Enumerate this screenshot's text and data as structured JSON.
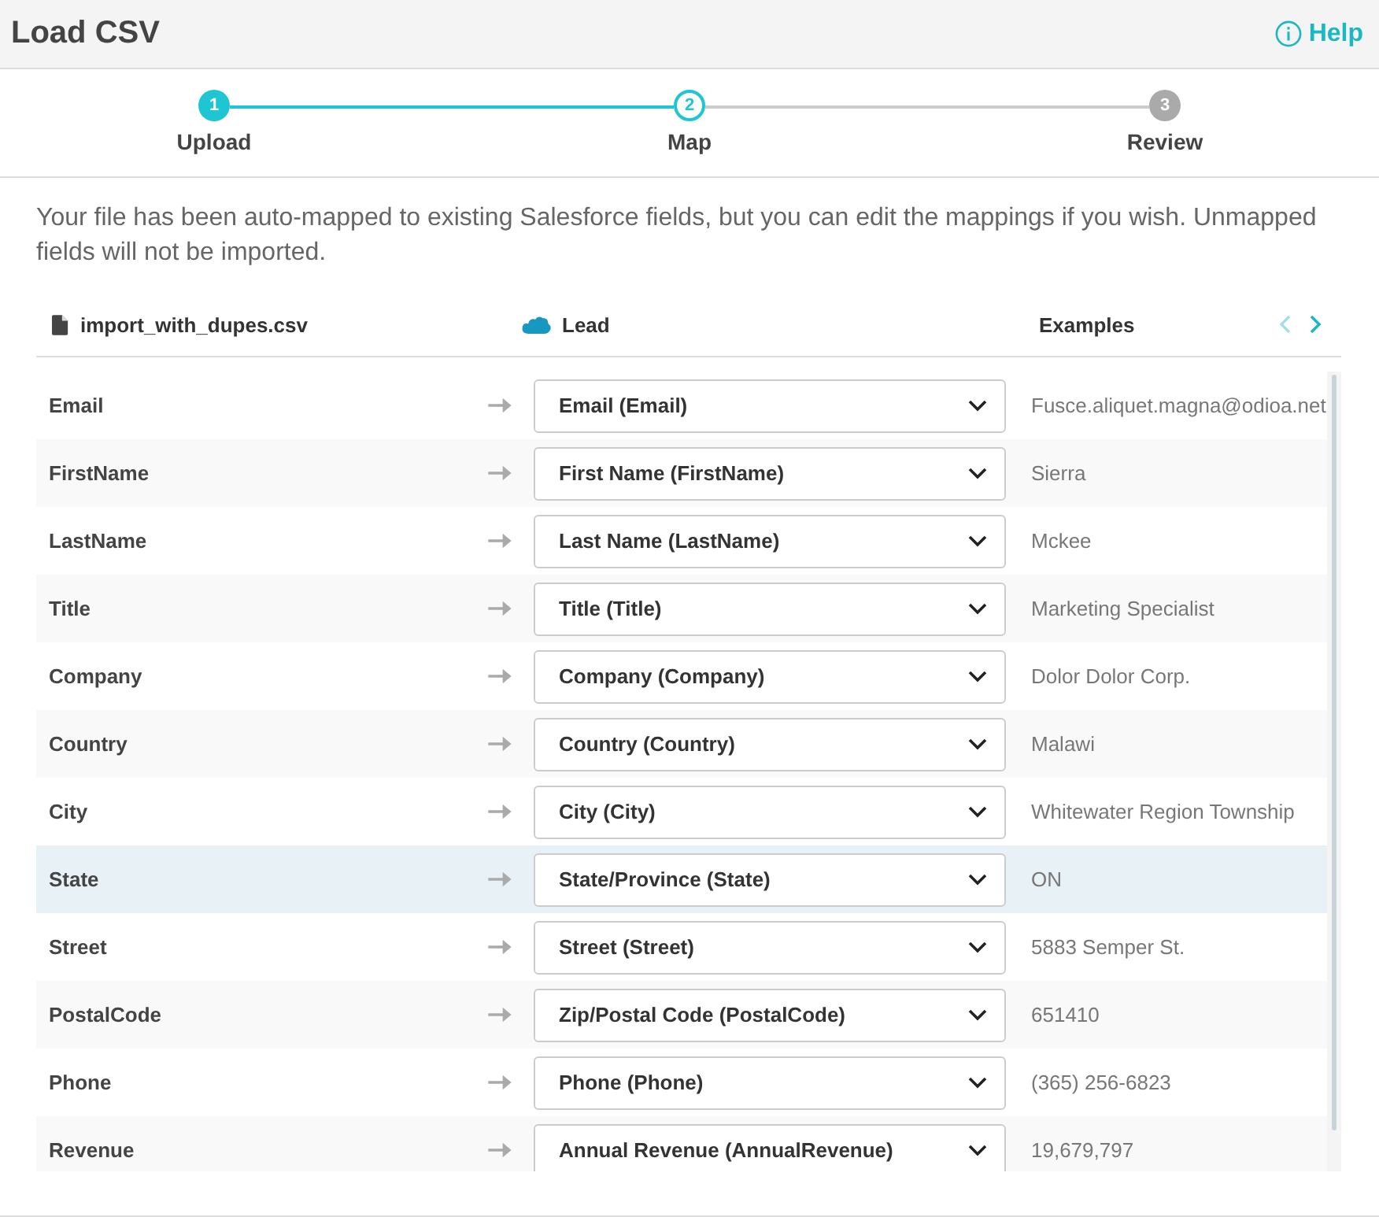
{
  "window": {
    "title": "Load CSV",
    "help": "Help"
  },
  "steps": [
    {
      "number": "1",
      "label": "Upload",
      "completed": true,
      "selected": false
    },
    {
      "number": "2",
      "label": "Map",
      "completed": false,
      "selected": true
    },
    {
      "number": "3",
      "label": "Review",
      "completed": false,
      "selected": false
    }
  ],
  "description": "Your file has been auto-mapped to existing Salesforce fields, but you can edit the mappings if you wish. Unmapped fields will not be imported.",
  "columns": {
    "file": "import_with_dupes.csv",
    "object": "Lead",
    "examples": "Examples"
  },
  "rows": [
    {
      "source": "Email",
      "target": "Email (Email)",
      "example": "Fusce.aliquet.magna@odioa.net",
      "selected": false
    },
    {
      "source": "FirstName",
      "target": "First Name (FirstName)",
      "example": "Sierra",
      "selected": false
    },
    {
      "source": "LastName",
      "target": "Last Name (LastName)",
      "example": "Mckee",
      "selected": false
    },
    {
      "source": "Title",
      "target": "Title (Title)",
      "example": "Marketing Specialist",
      "selected": false
    },
    {
      "source": "Company",
      "target": "Company (Company)",
      "example": "Dolor Dolor Corp.",
      "selected": false
    },
    {
      "source": "Country",
      "target": "Country (Country)",
      "example": "Malawi",
      "selected": false
    },
    {
      "source": "City",
      "target": "City (City)",
      "example": "Whitewater Region Township",
      "selected": false
    },
    {
      "source": "State",
      "target": "State/Province (State)",
      "example": "ON",
      "selected": true
    },
    {
      "source": "Street",
      "target": "Street (Street)",
      "example": "5883 Semper St.",
      "selected": false
    },
    {
      "source": "PostalCode",
      "target": "Zip/Postal Code (PostalCode)",
      "example": "651410",
      "selected": false
    },
    {
      "source": "Phone",
      "target": "Phone (Phone)",
      "example": "(365) 256-6823",
      "selected": false
    },
    {
      "source": "Revenue",
      "target": "Annual Revenue (AnnualRevenue)",
      "example": "19,679,797",
      "selected": false
    }
  ]
}
